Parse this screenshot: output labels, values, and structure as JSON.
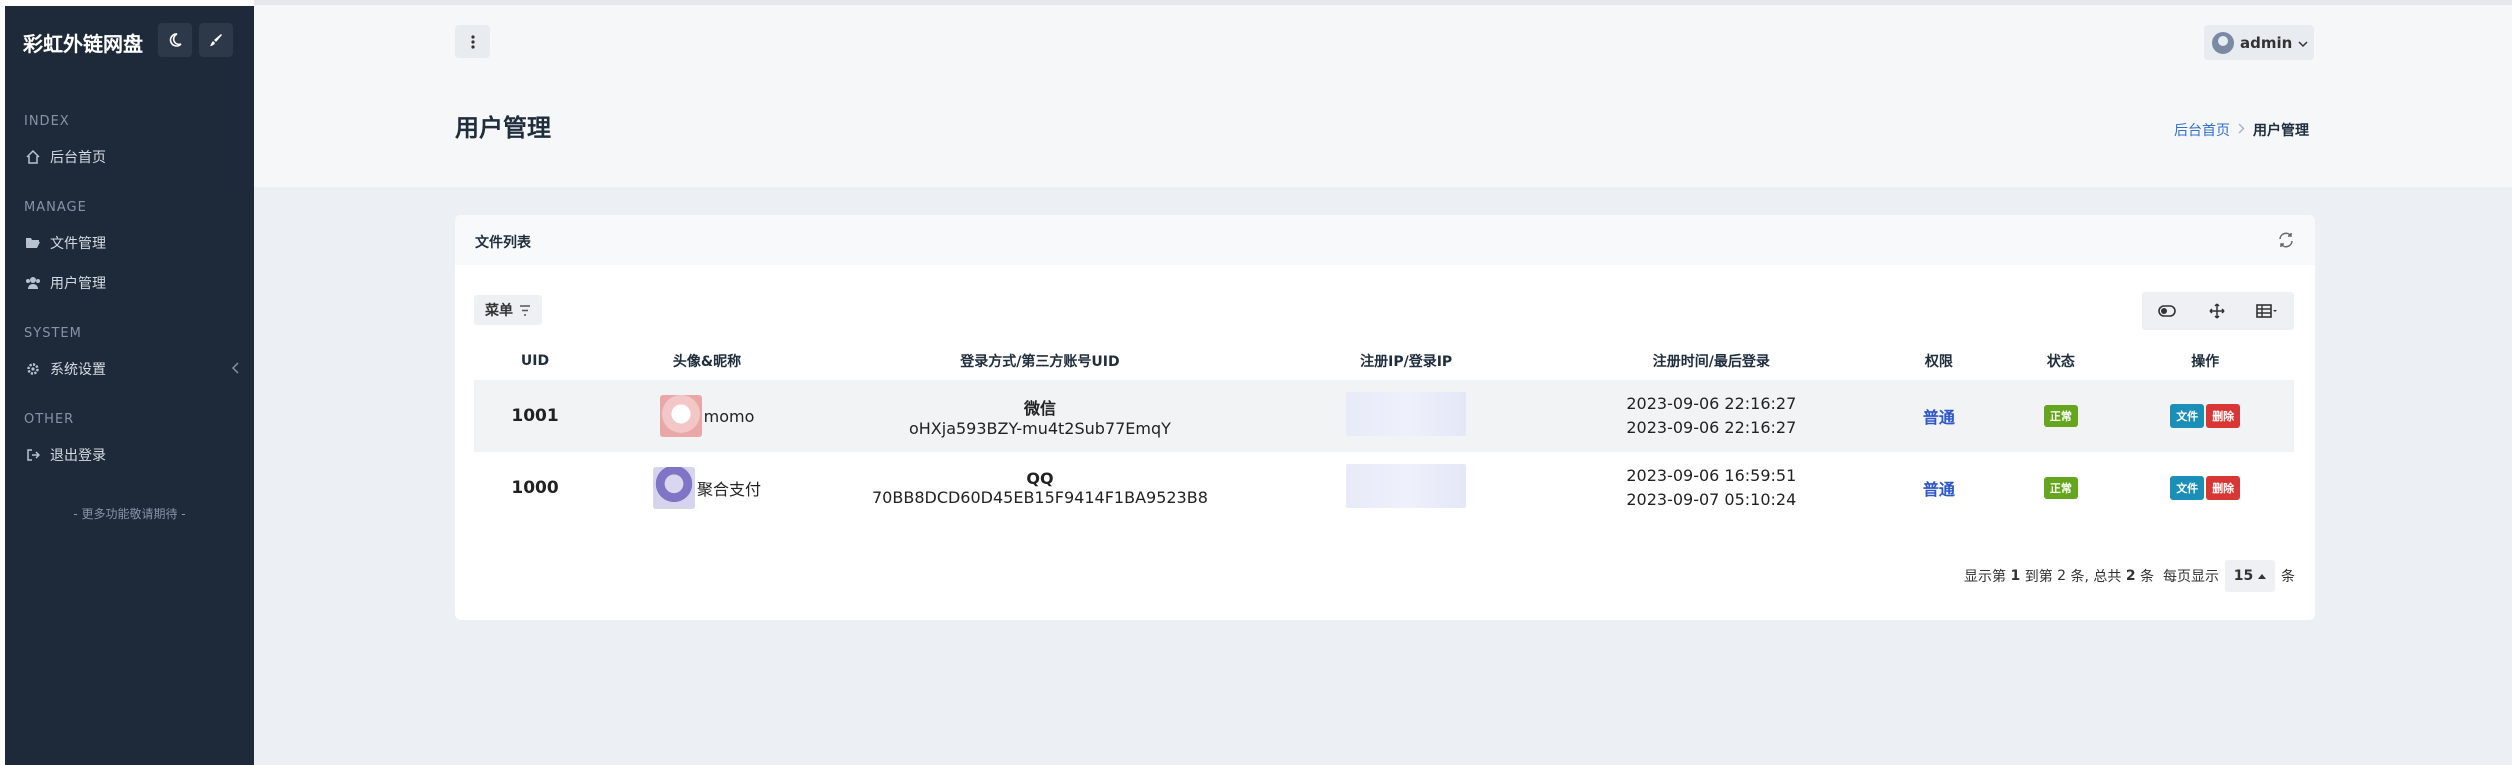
{
  "brand": {
    "title": "彩虹外链网盘"
  },
  "sidebar": {
    "sections": [
      {
        "header": "INDEX",
        "items": [
          {
            "label": "后台首页",
            "icon": "home-icon"
          }
        ]
      },
      {
        "header": "MANAGE",
        "items": [
          {
            "label": "文件管理",
            "icon": "folder-open-icon"
          },
          {
            "label": "用户管理",
            "icon": "users-icon"
          }
        ]
      },
      {
        "header": "SYSTEM",
        "items": [
          {
            "label": "系统设置",
            "icon": "gear-icon"
          }
        ]
      },
      {
        "header": "OTHER",
        "items": [
          {
            "label": "退出登录",
            "icon": "sign-out-icon"
          }
        ]
      }
    ],
    "more": "- 更多功能敬请期待 -"
  },
  "topbar": {
    "user": "admin"
  },
  "page": {
    "title": "用户管理"
  },
  "breadcrumb": {
    "home": "后台首页",
    "current": "用户管理"
  },
  "card": {
    "title": "文件列表",
    "menu_label": "菜单"
  },
  "table": {
    "headers": [
      "UID",
      "头像&昵称",
      "登录方式/第三方账号UID",
      "注册IP/登录IP",
      "注册时间/最后登录",
      "权限",
      "状态",
      "操作"
    ],
    "rows": [
      {
        "uid": "1001",
        "nickname": "momo",
        "login_type": "微信",
        "login_uid": "oHXja593BZY-mu4t2Sub77EmqY",
        "reg_time": "2023-09-06 22:16:27",
        "last_login": "2023-09-06 22:16:27",
        "permission": "普通",
        "status": "正常",
        "op_file": "文件",
        "op_delete": "删除"
      },
      {
        "uid": "1000",
        "nickname": "聚合支付",
        "login_type": "QQ",
        "login_uid": "70BB8DCD60D45EB15F9414F1BA9523B8",
        "reg_time": "2023-09-06 16:59:51",
        "last_login": "2023-09-07 05:10:24",
        "permission": "普通",
        "status": "正常",
        "op_file": "文件",
        "op_delete": "删除"
      }
    ]
  },
  "pager": {
    "prefix": "显示第",
    "from": "1",
    "mid1": "到第",
    "to": "2",
    "mid2": "条, 总共",
    "total": "2",
    "mid3": "条",
    "per_page_prefix": "每页显示",
    "page_size": "15",
    "suffix": "条"
  },
  "colors": {
    "sidebar": "#1e2939",
    "accent": "#2e56c8",
    "status_ok": "#66a61e",
    "danger": "#d93636",
    "info": "#1b8fb8"
  }
}
